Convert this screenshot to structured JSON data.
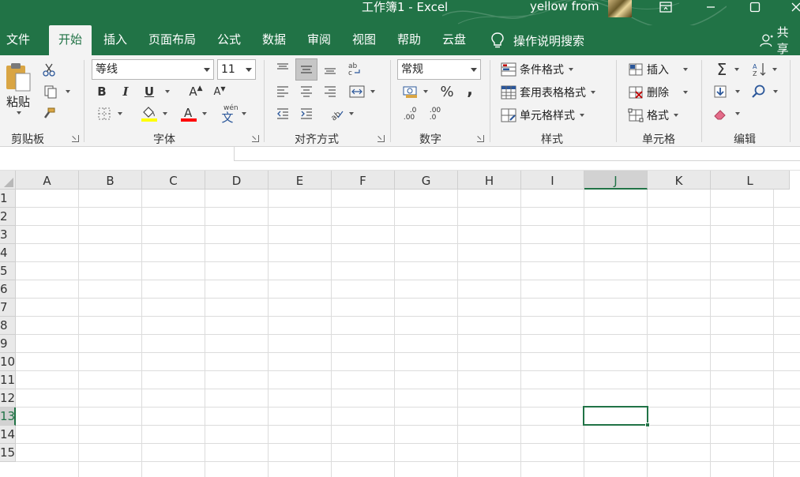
{
  "titlebar": {
    "title": "工作簿1  -  Excel",
    "user_name": "yellow from",
    "colors": {
      "background": "#217346",
      "text": "#ffffff"
    }
  },
  "tabs": [
    {
      "id": "file",
      "label": "文件"
    },
    {
      "id": "home",
      "label": "开始",
      "active": true
    },
    {
      "id": "insert",
      "label": "插入"
    },
    {
      "id": "page-layout",
      "label": "页面布局"
    },
    {
      "id": "formulas",
      "label": "公式"
    },
    {
      "id": "data",
      "label": "数据"
    },
    {
      "id": "review",
      "label": "审阅"
    },
    {
      "id": "view",
      "label": "视图"
    },
    {
      "id": "help",
      "label": "帮助"
    },
    {
      "id": "cloud",
      "label": "云盘"
    }
  ],
  "help_search": {
    "label": "操作说明搜索",
    "icon": "lightbulb-icon"
  },
  "share": {
    "label": "共享",
    "icon": "person-icon"
  },
  "ribbon": {
    "clipboard": {
      "label": "剪贴板",
      "paste_label": "粘贴"
    },
    "font": {
      "label": "字体",
      "font_name": "等线",
      "font_size": "11",
      "bold": "B",
      "italic": "I",
      "underline": "U",
      "grow": "A",
      "shrink": "A",
      "phonetic": "wén"
    },
    "alignment": {
      "label": "对齐方式"
    },
    "number": {
      "label": "数字",
      "format": "常规",
      "percent": "%",
      "comma": ",",
      "inc_decimal_top": ".0",
      "inc_decimal_bottom": ".00",
      "dec_decimal_top": ".00",
      "dec_decimal_bottom": ".0"
    },
    "styles": {
      "label": "样式",
      "conditional": "条件格式",
      "table": "套用表格格式",
      "cell_styles": "单元格样式"
    },
    "cells": {
      "label": "单元格",
      "insert": "插入",
      "delete": "删除",
      "format": "格式"
    },
    "editing": {
      "label": "编辑",
      "autosum": "Σ"
    },
    "colors": {
      "highlight": "#ffff00",
      "font_color": "#ff0000",
      "accent": "#217346"
    }
  },
  "grid": {
    "columns": [
      "A",
      "B",
      "C",
      "D",
      "E",
      "F",
      "G",
      "H",
      "I",
      "J",
      "K",
      "L"
    ],
    "rows": [
      "1",
      "2",
      "3",
      "4",
      "5",
      "6",
      "7",
      "8",
      "9",
      "10",
      "11",
      "12",
      "13",
      "14",
      "15"
    ],
    "selected_column": "J",
    "selected_row": "13"
  }
}
